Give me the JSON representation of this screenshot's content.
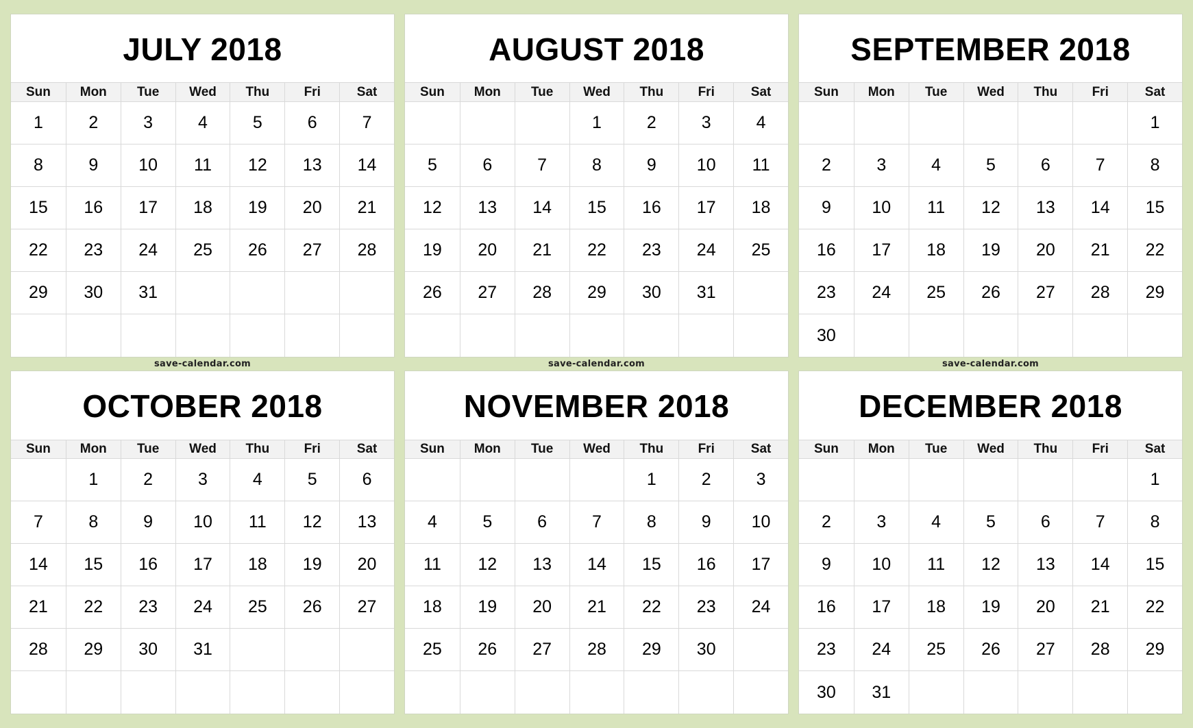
{
  "colors": {
    "background": "#d8e4bc",
    "panel": "#ffffff",
    "weekday_header": "#f2f2f2",
    "grid_line": "#d9d9d9",
    "text": "#000000"
  },
  "weekdays": [
    "Sun",
    "Mon",
    "Tue",
    "Wed",
    "Thu",
    "Fri",
    "Sat"
  ],
  "footer_text": "save-calendar.com",
  "months": [
    {
      "title": "JULY 2018",
      "weeks": [
        [
          "1",
          "2",
          "3",
          "4",
          "5",
          "6",
          "7"
        ],
        [
          "8",
          "9",
          "10",
          "11",
          "12",
          "13",
          "14"
        ],
        [
          "15",
          "16",
          "17",
          "18",
          "19",
          "20",
          "21"
        ],
        [
          "22",
          "23",
          "24",
          "25",
          "26",
          "27",
          "28"
        ],
        [
          "29",
          "30",
          "31",
          "",
          "",
          "",
          ""
        ],
        [
          "",
          "",
          "",
          "",
          "",
          "",
          ""
        ]
      ]
    },
    {
      "title": "AUGUST 2018",
      "weeks": [
        [
          "",
          "",
          "",
          "1",
          "2",
          "3",
          "4"
        ],
        [
          "5",
          "6",
          "7",
          "8",
          "9",
          "10",
          "11"
        ],
        [
          "12",
          "13",
          "14",
          "15",
          "16",
          "17",
          "18"
        ],
        [
          "19",
          "20",
          "21",
          "22",
          "23",
          "24",
          "25"
        ],
        [
          "26",
          "27",
          "28",
          "29",
          "30",
          "31",
          ""
        ],
        [
          "",
          "",
          "",
          "",
          "",
          "",
          ""
        ]
      ]
    },
    {
      "title": "SEPTEMBER 2018",
      "weeks": [
        [
          "",
          "",
          "",
          "",
          "",
          "",
          "1"
        ],
        [
          "2",
          "3",
          "4",
          "5",
          "6",
          "7",
          "8"
        ],
        [
          "9",
          "10",
          "11",
          "12",
          "13",
          "14",
          "15"
        ],
        [
          "16",
          "17",
          "18",
          "19",
          "20",
          "21",
          "22"
        ],
        [
          "23",
          "24",
          "25",
          "26",
          "27",
          "28",
          "29"
        ],
        [
          "30",
          "",
          "",
          "",
          "",
          "",
          ""
        ]
      ]
    },
    {
      "title": "OCTOBER 2018",
      "weeks": [
        [
          "",
          "1",
          "2",
          "3",
          "4",
          "5",
          "6"
        ],
        [
          "7",
          "8",
          "9",
          "10",
          "11",
          "12",
          "13"
        ],
        [
          "14",
          "15",
          "16",
          "17",
          "18",
          "19",
          "20"
        ],
        [
          "21",
          "22",
          "23",
          "24",
          "25",
          "26",
          "27"
        ],
        [
          "28",
          "29",
          "30",
          "31",
          "",
          "",
          ""
        ],
        [
          "",
          "",
          "",
          "",
          "",
          "",
          ""
        ]
      ]
    },
    {
      "title": "NOVEMBER 2018",
      "weeks": [
        [
          "",
          "",
          "",
          "",
          "1",
          "2",
          "3"
        ],
        [
          "4",
          "5",
          "6",
          "7",
          "8",
          "9",
          "10"
        ],
        [
          "11",
          "12",
          "13",
          "14",
          "15",
          "16",
          "17"
        ],
        [
          "18",
          "19",
          "20",
          "21",
          "22",
          "23",
          "24"
        ],
        [
          "25",
          "26",
          "27",
          "28",
          "29",
          "30",
          ""
        ],
        [
          "",
          "",
          "",
          "",
          "",
          "",
          ""
        ]
      ]
    },
    {
      "title": "DECEMBER 2018",
      "weeks": [
        [
          "",
          "",
          "",
          "",
          "",
          "",
          "1"
        ],
        [
          "2",
          "3",
          "4",
          "5",
          "6",
          "7",
          "8"
        ],
        [
          "9",
          "10",
          "11",
          "12",
          "13",
          "14",
          "15"
        ],
        [
          "16",
          "17",
          "18",
          "19",
          "20",
          "21",
          "22"
        ],
        [
          "23",
          "24",
          "25",
          "26",
          "27",
          "28",
          "29"
        ],
        [
          "30",
          "31",
          "",
          "",
          "",
          "",
          ""
        ]
      ]
    }
  ]
}
